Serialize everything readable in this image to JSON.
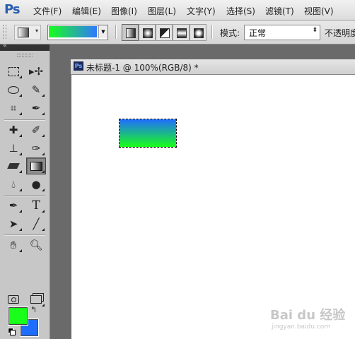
{
  "app": {
    "logo": "Ps"
  },
  "menu": [
    "文件(F)",
    "编辑(E)",
    "图像(I)",
    "图层(L)",
    "文字(Y)",
    "选择(S)",
    "滤镜(T)",
    "视图(V)"
  ],
  "options": {
    "gradient_colors": [
      "#19ff19",
      "#2f78ff"
    ],
    "gradient_types": [
      "linear-gradient-icon",
      "radial-gradient-icon",
      "angle-gradient-icon",
      "reflected-gradient-icon",
      "diamond-gradient-icon"
    ],
    "mode_label": "模式:",
    "mode_value": "正常",
    "opacity_label": "不透明度"
  },
  "toolbox": {
    "tools": [
      "rectangular-marquee-icon",
      "move-icon",
      "lasso-icon",
      "quick-selection-icon",
      "crop-icon",
      "eyedropper-icon",
      "spot-healing-icon",
      "brush-icon",
      "clone-stamp-icon",
      "history-brush-icon",
      "eraser-icon",
      "gradient-icon",
      "blur-icon",
      "dodge-icon",
      "pen-icon",
      "type-icon",
      "path-selection-icon",
      "line-icon",
      "hand-icon",
      "zoom-icon",
      "quick-mask-icon",
      "screen-mode-icon"
    ],
    "active_tool": "gradient-icon",
    "foreground_color": "#19ff19",
    "background_color": "#1f6dff",
    "type_glyph": "T"
  },
  "document": {
    "title": "未标题-1 @ 100%(RGB/8) *",
    "icon_text": "Ps",
    "selection_gradient": [
      "#1f6dff",
      "#19ff19"
    ]
  },
  "watermark": {
    "main": "Bai du 经验",
    "sub": "jingyan.baidu.com"
  }
}
